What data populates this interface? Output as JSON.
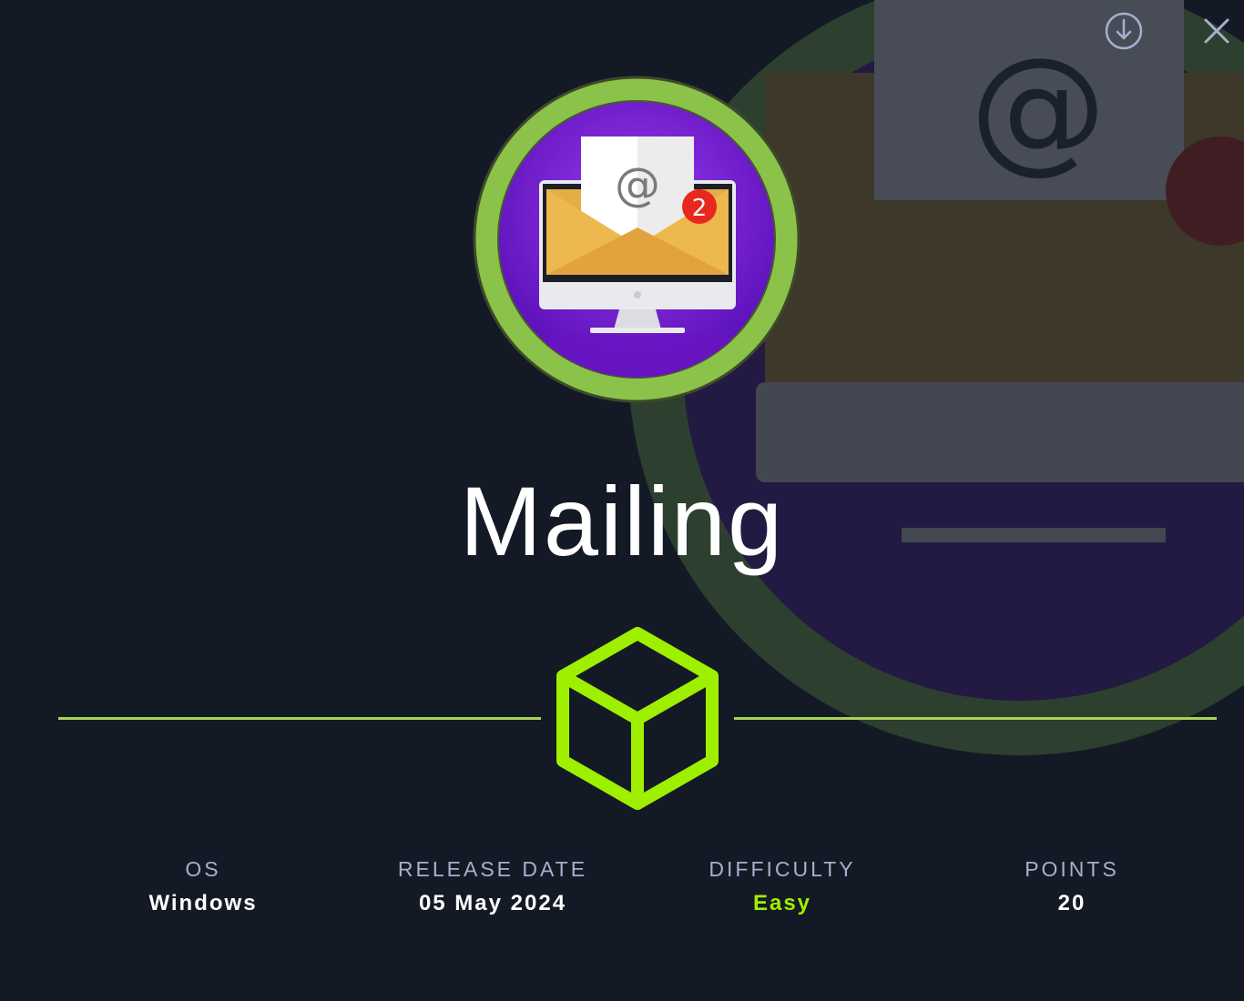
{
  "machine": {
    "name": "Mailing",
    "badge_notification": "2",
    "badge_symbol": "@"
  },
  "actions": {
    "download_icon": "download-icon",
    "close_icon": "close-icon"
  },
  "stats": [
    {
      "label": "OS",
      "value": "Windows"
    },
    {
      "label": "RELEASE DATE",
      "value": "05 May 2024"
    },
    {
      "label": "DIFFICULTY",
      "value": "Easy"
    },
    {
      "label": "POINTS",
      "value": "20"
    }
  ],
  "colors": {
    "background": "#131a26",
    "accent_green": "#9fef00",
    "ring_green": "#8bc34a",
    "badge_purple": "#7a1fd6",
    "label_gray": "#a4b1cd"
  }
}
